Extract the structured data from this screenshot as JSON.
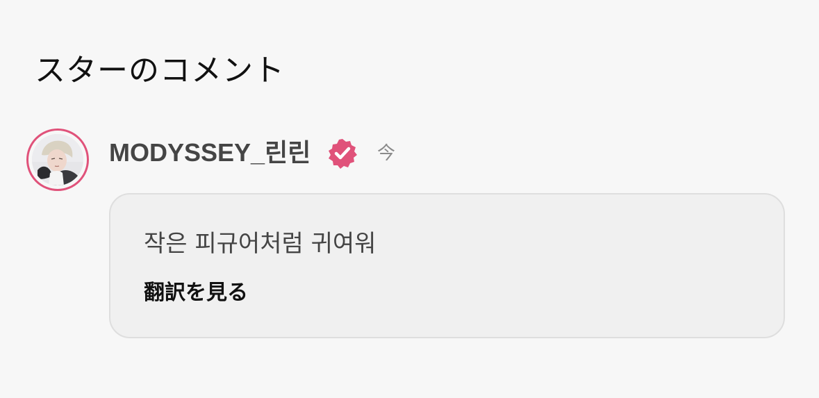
{
  "section": {
    "title": "スターのコメント"
  },
  "comment": {
    "author": "MODYSSEY_린린",
    "time": "今",
    "text": "작은 피규어처럼 귀여워",
    "translate_label": "翻訳を見る",
    "verified_icon": "verified-badge-icon",
    "avatar_icon": "avatar-photo"
  },
  "colors": {
    "background": "#f7f7f7",
    "accent": "#e0527a",
    "bubble": "#f0f0f0",
    "bubble_border": "#dedede",
    "author": "#454545",
    "time": "#8a8a8a"
  }
}
